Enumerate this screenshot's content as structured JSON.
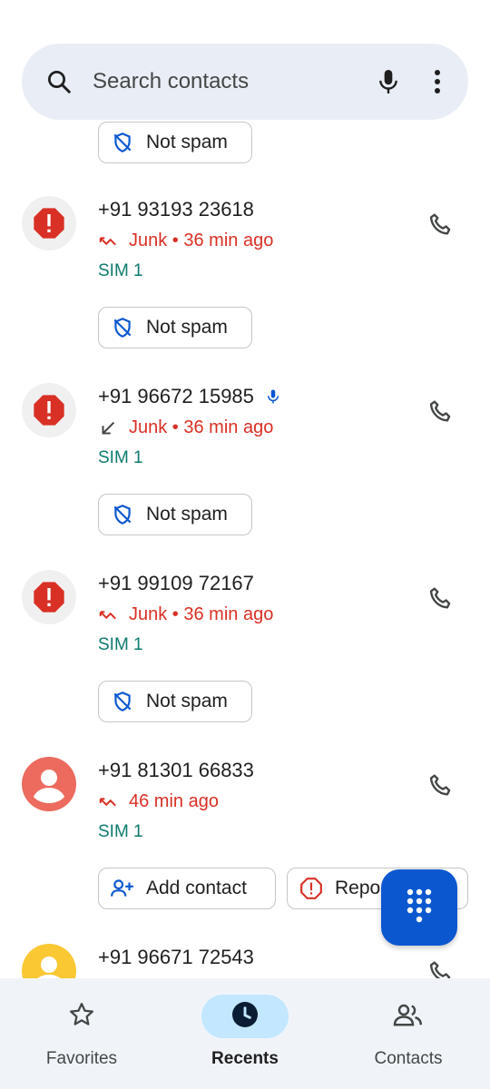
{
  "search": {
    "placeholder": "Search contacts",
    "icons": [
      "search-icon",
      "mic-icon",
      "more-vert-icon"
    ]
  },
  "calls": [
    {
      "number": "+91 93193 23618",
      "type": "missed",
      "type_icon": "missed-call-icon",
      "status": "Junk • 36 min ago",
      "sim": "SIM 1",
      "avatar": "spam-alert-icon",
      "voicemail": false,
      "actions": [
        {
          "label": "Not spam",
          "icon": "not-spam-icon"
        }
      ]
    },
    {
      "number": "+91 96672 15985",
      "type": "incoming",
      "type_icon": "incoming-call-icon",
      "status": "Junk • 36 min ago",
      "sim": "SIM 1",
      "avatar": "spam-alert-icon",
      "voicemail": true,
      "actions": [
        {
          "label": "Not spam",
          "icon": "not-spam-icon"
        }
      ]
    },
    {
      "number": "+91 99109 72167",
      "type": "missed",
      "type_icon": "missed-call-icon",
      "status": "Junk • 36 min ago",
      "sim": "SIM 1",
      "avatar": "spam-alert-icon",
      "voicemail": false,
      "actions": [
        {
          "label": "Not spam",
          "icon": "not-spam-icon"
        }
      ]
    },
    {
      "number": "+91 81301 66833",
      "type": "missed",
      "type_icon": "missed-call-icon",
      "status": "46 min ago",
      "sim": "SIM 1",
      "avatar": "person-icon",
      "voicemail": false,
      "actions": [
        {
          "label": "Add contact",
          "icon": "add-contact-icon"
        },
        {
          "label": "Report",
          "icon": "report-icon"
        }
      ]
    },
    {
      "number": "+91 96671 72543",
      "avatar": "person-icon"
    }
  ],
  "top_partial_action": {
    "label": "Not spam",
    "icon": "not-spam-icon"
  },
  "fab": {
    "icon": "dialpad-icon"
  },
  "nav": {
    "items": [
      {
        "label": "Favorites",
        "icon": "star-icon",
        "active": false
      },
      {
        "label": "Recents",
        "icon": "clock-icon",
        "active": true
      },
      {
        "label": "Contacts",
        "icon": "people-icon",
        "active": false
      }
    ]
  },
  "colors": {
    "junk_red": "#d93025",
    "sim_teal": "#0d7a6e",
    "accent_blue": "#0b57d0",
    "nav_active_pill": "#c2e7ff",
    "search_bg": "#e9eef6"
  }
}
